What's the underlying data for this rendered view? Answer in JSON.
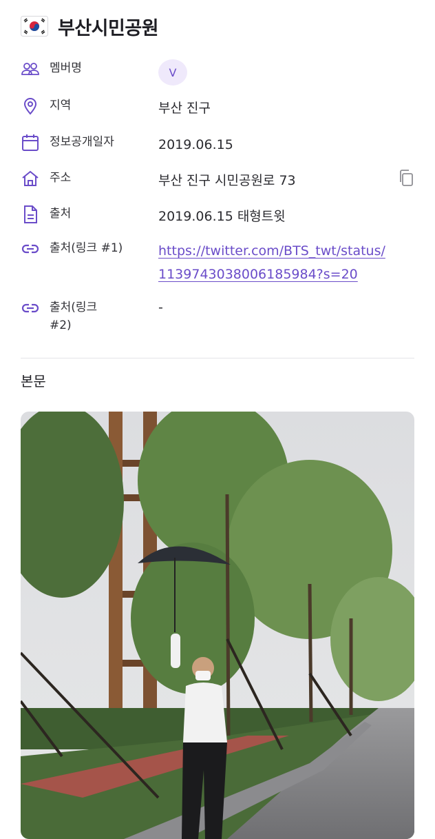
{
  "header": {
    "title": "부산시민공원"
  },
  "fields": {
    "member": {
      "label": "멤버명",
      "value": "V"
    },
    "region": {
      "label": "지역",
      "value": "부산 진구"
    },
    "date": {
      "label": "정보공개일자",
      "value": "2019.06.15"
    },
    "address": {
      "label": "주소",
      "value": "부산 진구 시민공원로 73"
    },
    "source": {
      "label": "출처",
      "value": "2019.06.15 태형트윗"
    },
    "link1": {
      "label": "출처(링크 #1)",
      "value_line1": "https://twitter.com/BTS_twt/status/",
      "value_line2": "1139743038006185984?s=20"
    },
    "link2": {
      "label_line1": "출처(링크",
      "label_line2": "#2)",
      "value": "-"
    }
  },
  "body_section": {
    "title": "본문"
  },
  "colors": {
    "accent": "#6a4cc9",
    "badge_bg": "#efe9fb"
  },
  "icons": [
    "flag-icon",
    "people-icon",
    "location-pin-icon",
    "calendar-icon",
    "home-icon",
    "document-icon",
    "link-icon",
    "copy-icon"
  ]
}
